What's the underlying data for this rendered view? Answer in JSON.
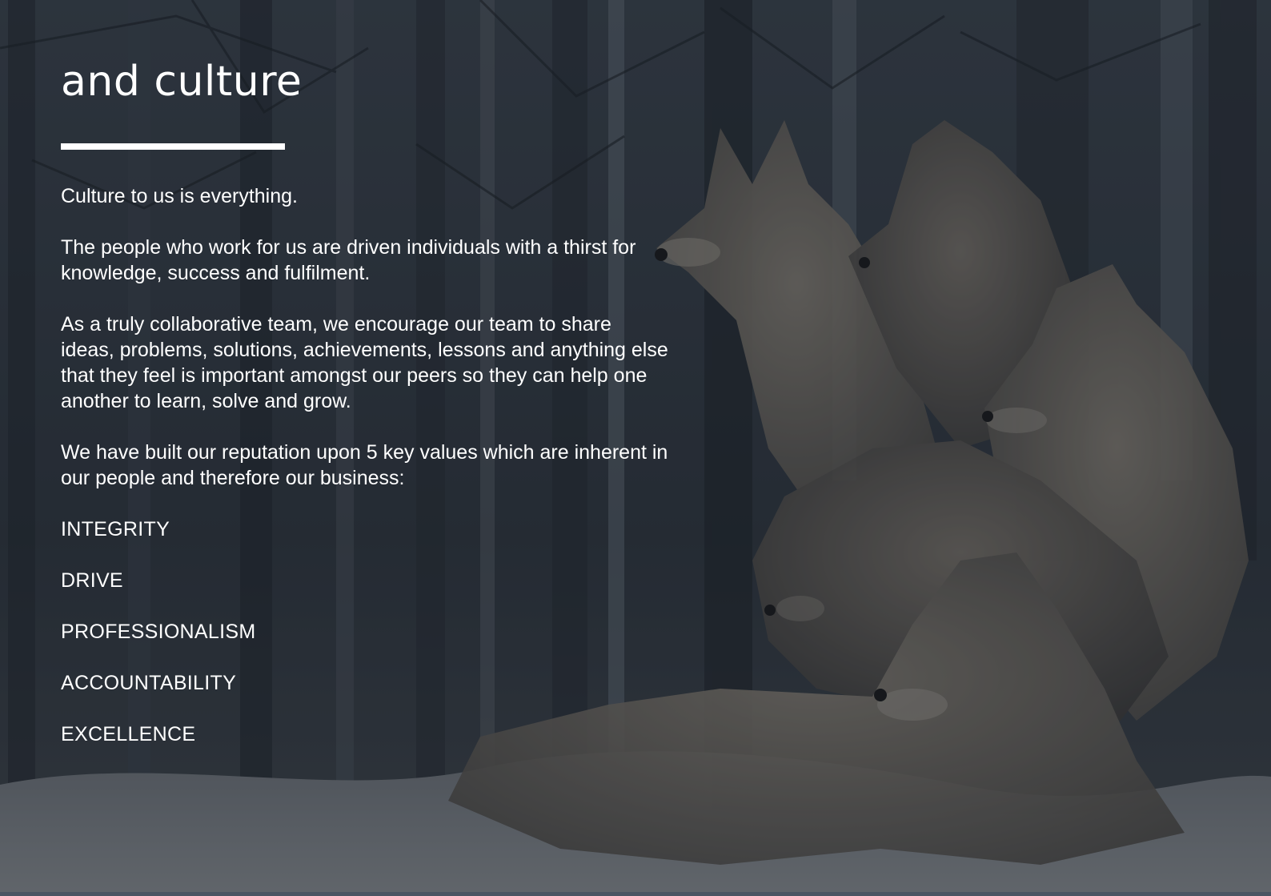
{
  "section": {
    "heading": "and culture",
    "paragraphs": [
      "Culture to us is everything.",
      "The people who work for us are driven individuals with a thirst for knowledge, success and fulfilment.",
      "As a truly collaborative team, we encourage our team to share ideas, problems, solutions, achievements, lessons and anything else that they feel is important amongst our peers so they can help one another to learn, solve and grow.",
      "We have built our reputation upon 5 key values which are inherent in our people and therefore our business:"
    ],
    "values": [
      "INTEGRITY",
      "DRIVE",
      "PROFESSIONALISM",
      "ACCOUNTABILITY",
      "EXCELLENCE"
    ]
  },
  "background": {
    "image": "wolf-pack-photo",
    "overlay_color": "#141a22"
  }
}
